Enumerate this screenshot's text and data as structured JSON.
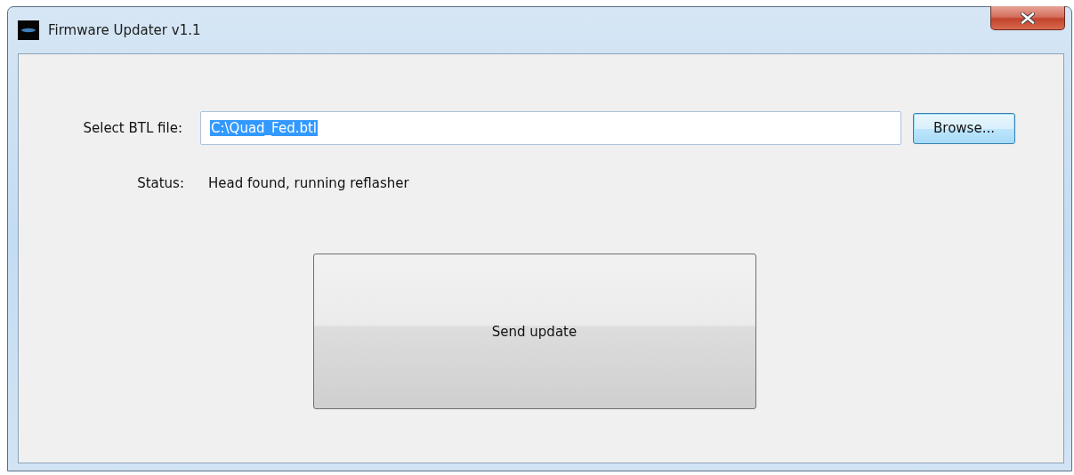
{
  "window": {
    "title": "Firmware Updater v1.1"
  },
  "file": {
    "label": "Select BTL file:",
    "value": "C:\\Quad_Fed.btl",
    "text_selected": true
  },
  "browse": {
    "label": "Browse...",
    "focused": true
  },
  "status": {
    "label": "Status:",
    "value": "Head found, running reflasher"
  },
  "send": {
    "label": "Send update"
  }
}
